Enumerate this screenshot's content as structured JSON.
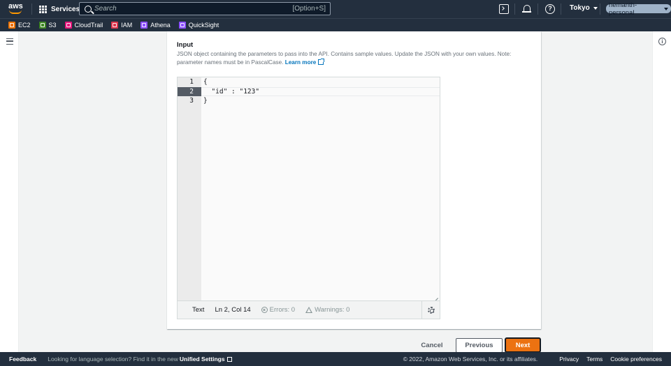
{
  "nav": {
    "logo": "aws",
    "services_label": "Services",
    "search_placeholder": "Search",
    "search_shortcut": "[Option+S]",
    "region": "Tokyo",
    "account": "hemanth-personal"
  },
  "favorites": [
    {
      "label": "EC2",
      "color": "#ed7100"
    },
    {
      "label": "S3",
      "color": "#3f8624"
    },
    {
      "label": "CloudTrail",
      "color": "#e7157b"
    },
    {
      "label": "IAM",
      "color": "#dd344c"
    },
    {
      "label": "Athena",
      "color": "#8c4fff"
    },
    {
      "label": "QuickSight",
      "color": "#8c4fff"
    }
  ],
  "main": {
    "input_title": "Input",
    "input_desc": "JSON object containing the parameters to pass into the API. Contains sample values. Update the JSON with your own values. Note: parameter names must be in PascalCase.",
    "learn_more": "Learn more"
  },
  "editor": {
    "lines": [
      {
        "num": "1",
        "code": "{"
      },
      {
        "num": "2",
        "code": "  \"id\" : \"123\""
      },
      {
        "num": "3",
        "code": "}"
      }
    ],
    "status": {
      "mode": "Text",
      "position": "Ln 2, Col 14",
      "errors": "Errors: 0",
      "warnings": "Warnings: 0"
    }
  },
  "actions": {
    "cancel": "Cancel",
    "previous": "Previous",
    "next": "Next"
  },
  "footer": {
    "feedback": "Feedback",
    "lang_text": "Looking for language selection? Find it in the new",
    "unified_settings": "Unified Settings",
    "copyright": "© 2022, Amazon Web Services, Inc. or its affiliates.",
    "privacy": "Privacy",
    "terms": "Terms",
    "cookie": "Cookie preferences"
  },
  "colors": {
    "nav_bg": "#232f3e",
    "accent": "#ec7211",
    "link": "#0073bb"
  }
}
